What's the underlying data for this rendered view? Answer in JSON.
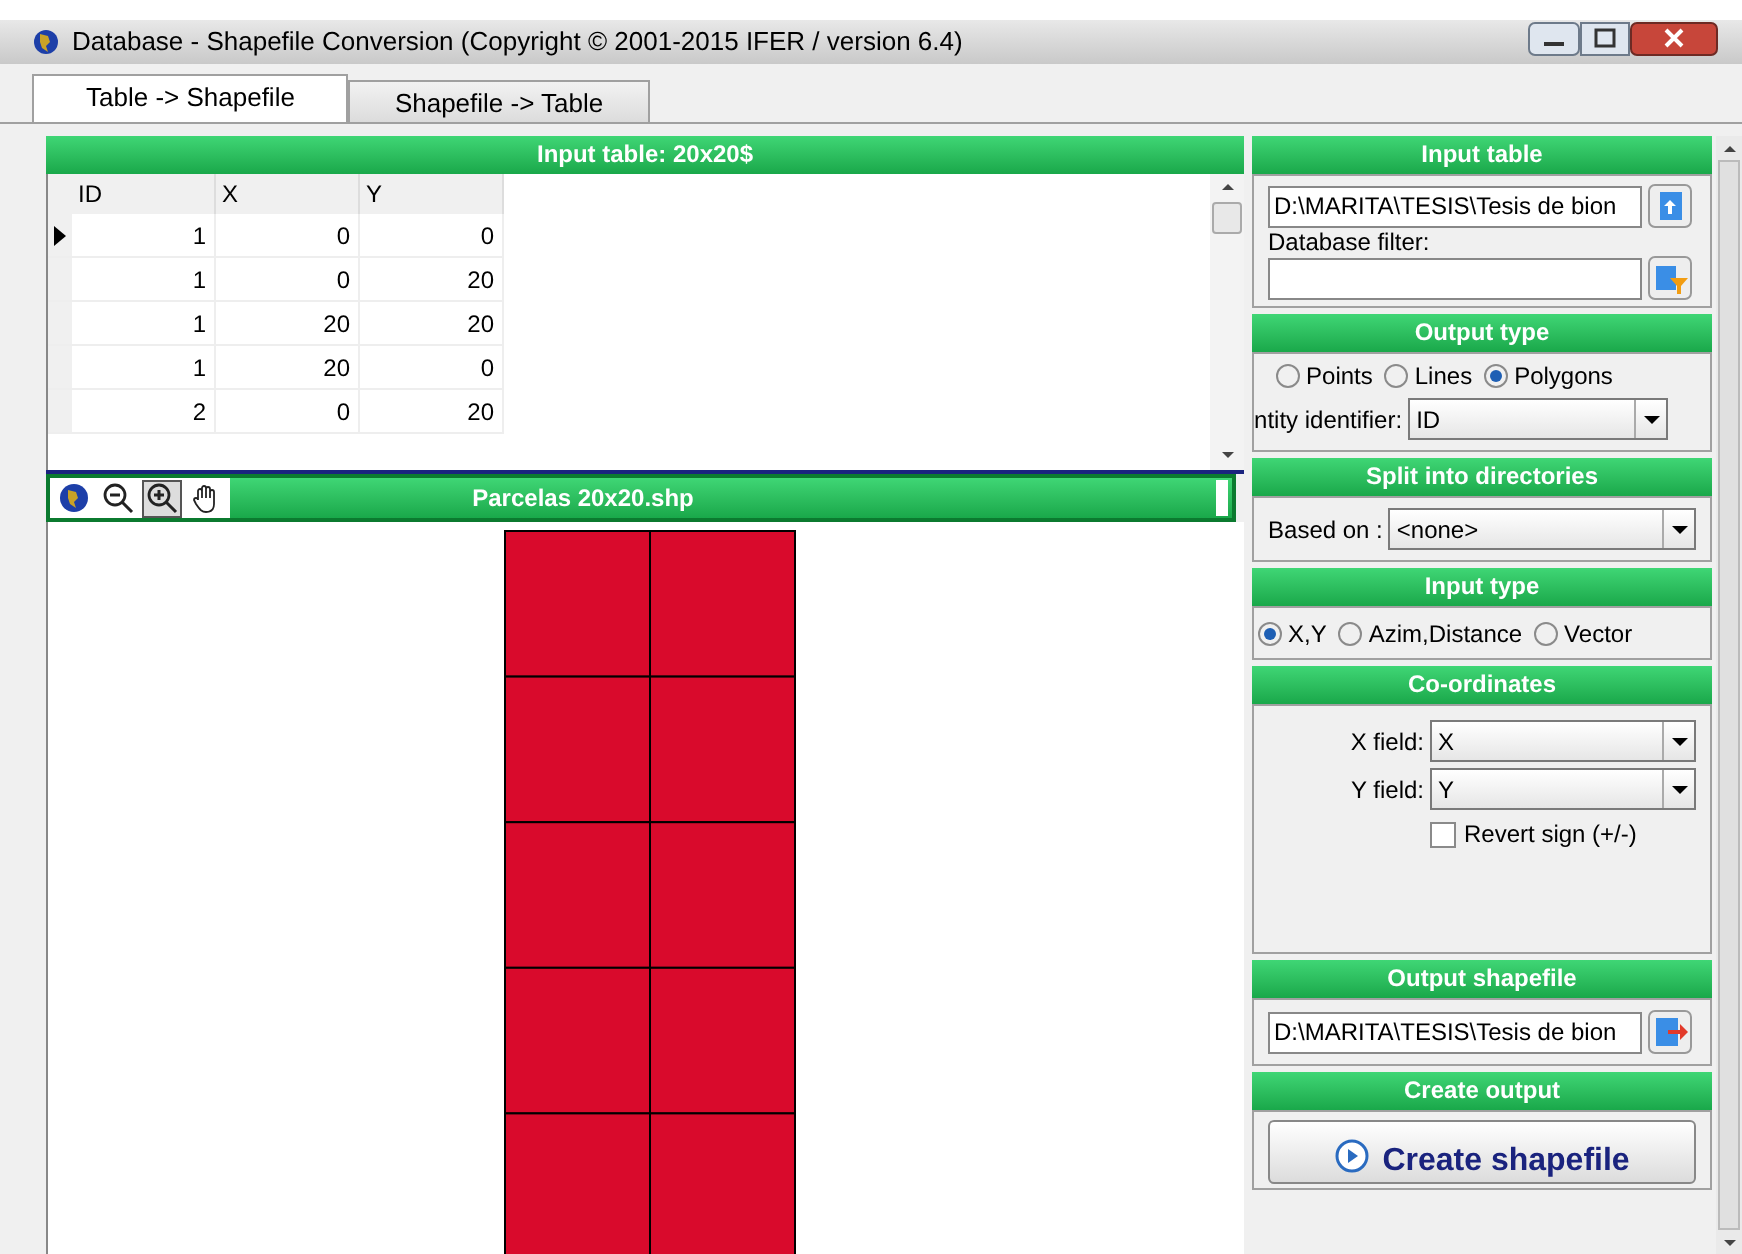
{
  "window": {
    "title": "Database - Shapefile Conversion (Copyright © 2001-2015 IFER / version 6.4)"
  },
  "tabs": [
    {
      "label": "Table -> Shapefile",
      "selected": true
    },
    {
      "label": "Shapefile -> Table",
      "selected": false
    }
  ],
  "input_table": {
    "title": "Input table: 20x20$",
    "columns": [
      "ID",
      "X",
      "Y"
    ],
    "rows": [
      {
        "cells": [
          "1",
          "0",
          "0"
        ],
        "selected": true
      },
      {
        "cells": [
          "1",
          "0",
          "20"
        ],
        "selected": false
      },
      {
        "cells": [
          "1",
          "20",
          "20"
        ],
        "selected": false
      },
      {
        "cells": [
          "1",
          "20",
          "0"
        ],
        "selected": false
      },
      {
        "cells": [
          "2",
          "0",
          "20"
        ],
        "selected": false
      }
    ]
  },
  "map": {
    "title": "Parcelas 20x20.shp",
    "tools": [
      {
        "kind": "globe",
        "selected": false
      },
      {
        "kind": "zoom-out",
        "selected": false
      },
      {
        "kind": "zoom-in",
        "selected": true
      },
      {
        "kind": "pan",
        "selected": false
      }
    ]
  },
  "sidebar": {
    "input_table": {
      "title": "Input table",
      "path": "D:\\MARITA\\TESIS\\Tesis de bion",
      "filter_label": "Database filter:"
    },
    "output_type": {
      "title": "Output type",
      "options": [
        {
          "label": "Points",
          "selected": false
        },
        {
          "label": "Lines",
          "selected": false
        },
        {
          "label": "Polygons",
          "selected": true
        }
      ],
      "identifier_label": "ntity identifier:",
      "identifier_value": "ID"
    },
    "split": {
      "title": "Split into directories",
      "label": "Based on :",
      "value": "<none>"
    },
    "input_type": {
      "title": "Input type",
      "options": [
        {
          "label": "X,Y",
          "selected": true
        },
        {
          "label": "Azim,Distance",
          "selected": false
        },
        {
          "label": "Vector",
          "selected": false
        }
      ]
    },
    "coordinates": {
      "title": "Co-ordinates",
      "x_label": "X field:",
      "x_value": "X",
      "y_label": "Y field:",
      "y_value": "Y",
      "revert_label": "Revert sign (+/-)",
      "revert_checked": false
    },
    "output_shapefile": {
      "title": "Output shapefile",
      "path": "D:\\MARITA\\TESIS\\Tesis de bion"
    },
    "create_output": {
      "title": "Create output",
      "button": "Create shapefile"
    }
  }
}
